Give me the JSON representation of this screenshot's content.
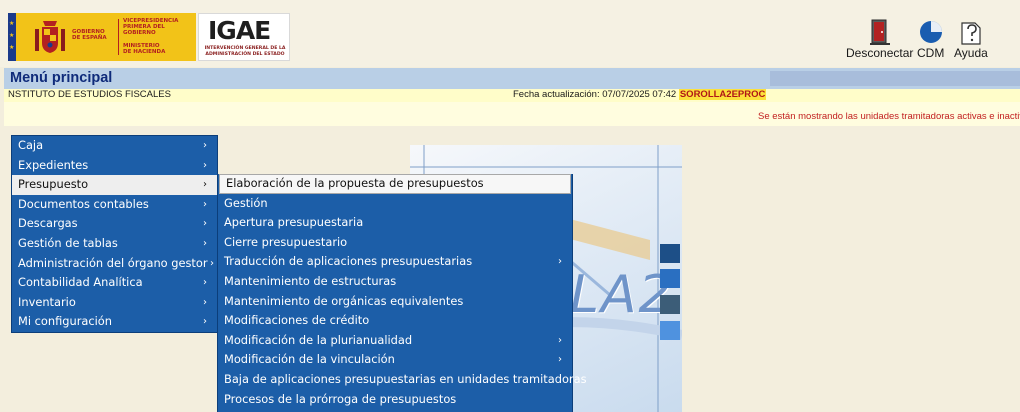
{
  "header": {
    "gov_logo": {
      "line1": "GOBIERNO",
      "line2": "DE ESPAÑA",
      "vp_line1": "VICEPRESIDENCIA",
      "vp_line2": "PRIMERA DEL GOBIERNO",
      "min_line1": "MINISTERIO",
      "min_line2": "DE HACIENDA"
    },
    "igae_logo": {
      "mark": "IGAE",
      "sub_line1": "INTERVENCIÓN GENERAL DE LA",
      "sub_line2": "ADMINISTRACIÓN DEL ESTADO"
    },
    "tools": [
      {
        "label": "Desconectar",
        "icon": "exit-door-icon"
      },
      {
        "label": "CDM",
        "icon": "pie-chart-icon"
      },
      {
        "label": "Ayuda",
        "icon": "help-document-icon"
      }
    ]
  },
  "title_bar": {
    "title": "Menú principal"
  },
  "info_bar": {
    "institution": "NSTITUTO DE ESTUDIOS FISCALES",
    "fecha_label": "Fecha actualización: 07/07/2025 07:42 ",
    "app_name": "SOROLLA2EPROC"
  },
  "notice": {
    "text": "Se están mostrando las unidades tramitadoras activas e inactivas"
  },
  "center_art": {
    "text": "LA2"
  },
  "main_menu": {
    "items": [
      {
        "label": "Caja",
        "has_submenu": true
      },
      {
        "label": "Expedientes",
        "has_submenu": true
      },
      {
        "label": "Presupuesto",
        "has_submenu": true,
        "selected": true
      },
      {
        "label": "Documentos contables",
        "has_submenu": true
      },
      {
        "label": "Descargas",
        "has_submenu": true
      },
      {
        "label": "Gestión de tablas",
        "has_submenu": true
      },
      {
        "label": "Administración del órgano gestor",
        "has_submenu": true
      },
      {
        "label": "Contabilidad Analítica",
        "has_submenu": true
      },
      {
        "label": "Inventario",
        "has_submenu": true
      },
      {
        "label": "Mi configuración",
        "has_submenu": true
      }
    ]
  },
  "sub_menu": {
    "items": [
      {
        "label": "Elaboración de la propuesta de presupuestos",
        "has_submenu": false,
        "selected": true
      },
      {
        "label": "Gestión",
        "has_submenu": false
      },
      {
        "label": "Apertura presupuestaria",
        "has_submenu": false
      },
      {
        "label": "Cierre presupuestario",
        "has_submenu": false
      },
      {
        "label": "Traducción de aplicaciones presupuestarias",
        "has_submenu": true
      },
      {
        "label": "Mantenimiento de estructuras",
        "has_submenu": false
      },
      {
        "label": "Mantenimiento de orgánicas equivalentes",
        "has_submenu": false
      },
      {
        "label": "Modificaciones de crédito",
        "has_submenu": false
      },
      {
        "label": "Modificación de la plurianualidad",
        "has_submenu": true
      },
      {
        "label": "Modificación de la vinculación",
        "has_submenu": true
      },
      {
        "label": "Baja de aplicaciones presupuestarias en unidades tramitadoras",
        "has_submenu": false
      },
      {
        "label": "Procesos de la prórroga de presupuestos",
        "has_submenu": false
      }
    ]
  },
  "colors": {
    "menu_bg": "#1c5ea8",
    "title_bar": "#b9cfe6",
    "info_bar": "#fffdc9",
    "notice_text": "#c22020"
  }
}
